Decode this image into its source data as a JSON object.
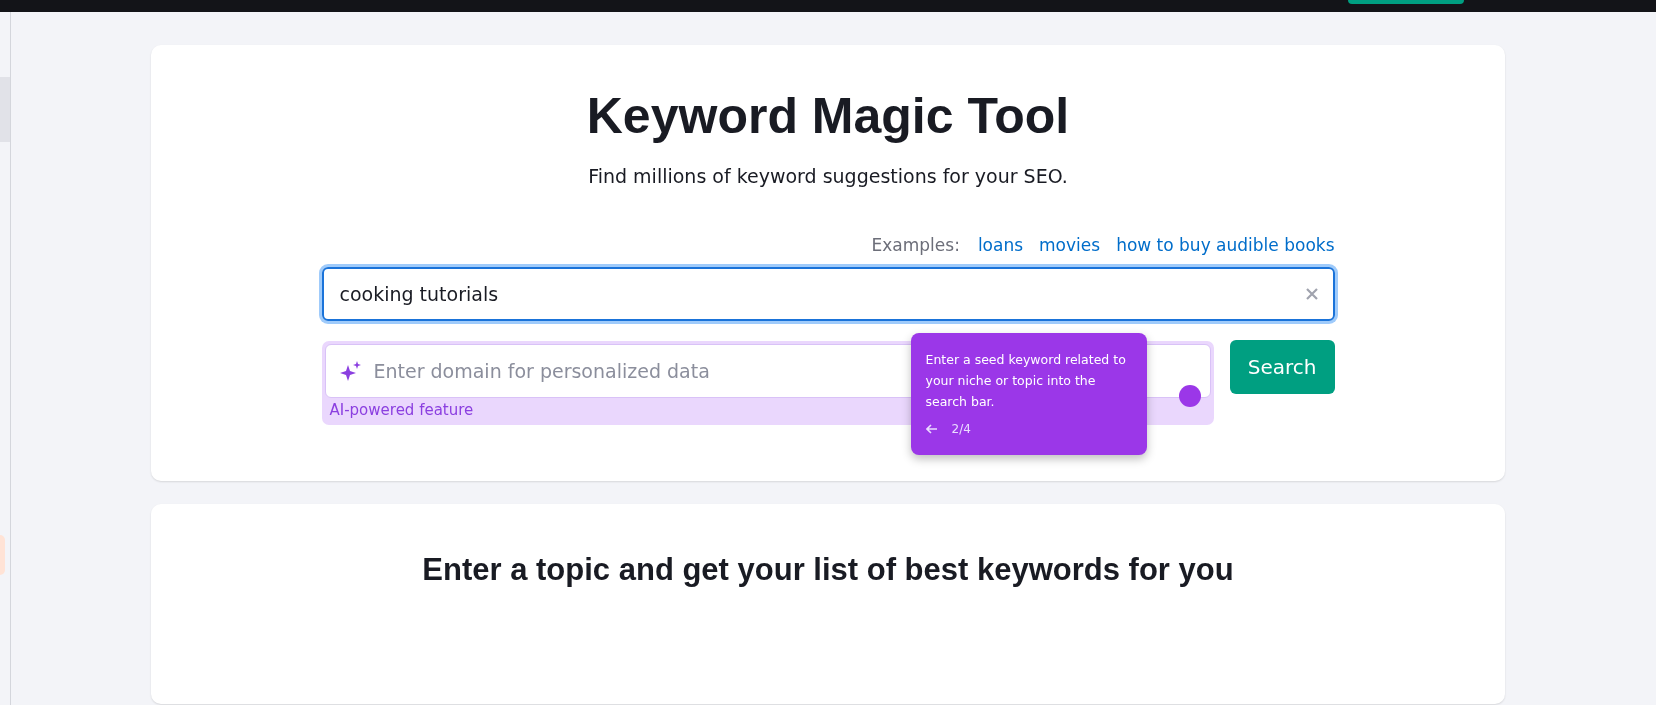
{
  "header": {
    "title": "Keyword Magic Tool",
    "subtitle": "Find millions of keyword suggestions for your SEO."
  },
  "examples": {
    "label": "Examples:",
    "links": [
      "loans",
      "movies",
      "how to buy audible books"
    ]
  },
  "keyword_field": {
    "value": "cooking tutorials"
  },
  "domain_field": {
    "placeholder": "Enter domain for personalized data",
    "note": "AI-powered feature"
  },
  "search_button": "Search",
  "tooltip": {
    "text": "Enter a seed keyword related to your niche or topic into the search bar.",
    "step": "2/4"
  },
  "second_card": {
    "title": "Enter a topic and get your list of best keywords for you"
  }
}
